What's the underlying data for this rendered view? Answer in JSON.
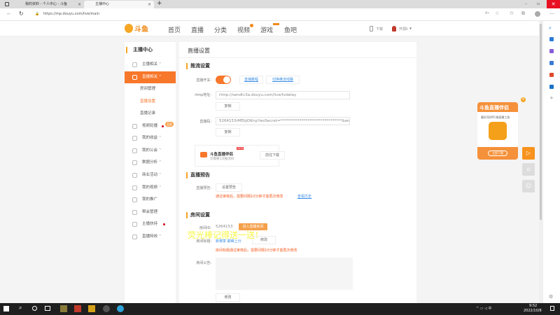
{
  "browser": {
    "tabs": [
      {
        "label": "我的资料 - 个人中心 - 斗鱼"
      },
      {
        "label": "主播中心"
      }
    ],
    "new_tab": "+",
    "url": "https://mp.douyu.com/live/main",
    "close": "×"
  },
  "header": {
    "logo": "斗鱼",
    "nav": [
      "首页",
      "直播",
      "分类",
      "视频",
      "游戏",
      "鱼吧"
    ],
    "download": "下载",
    "user": "开源li"
  },
  "sidebar": {
    "title": "主播中心",
    "items": [
      {
        "label": "主播相关",
        "type": "item"
      },
      {
        "label": "直播相关",
        "type": "active"
      },
      {
        "label": "房间管理",
        "type": "sub"
      },
      {
        "label": "直播设置",
        "type": "sub-active"
      },
      {
        "label": "直播记录",
        "type": "sub"
      },
      {
        "label": "视频轮播",
        "type": "item",
        "badge": "奖励"
      },
      {
        "label": "我的收益",
        "type": "item"
      },
      {
        "label": "我的公会",
        "type": "item"
      },
      {
        "label": "数据分析",
        "type": "item"
      },
      {
        "label": "商业活动",
        "type": "item"
      },
      {
        "label": "我的视频",
        "type": "item"
      },
      {
        "label": "我的推广",
        "type": "item"
      },
      {
        "label": "帮会管理",
        "type": "item"
      },
      {
        "label": "主播扶持",
        "type": "item"
      },
      {
        "label": "直播特效",
        "type": "item"
      }
    ]
  },
  "main": {
    "title": "直播设置",
    "push": {
      "heading": "推流设置",
      "switch_label": "直播开关:",
      "switch_on": true,
      "tutorial": "直播教程",
      "switch_line": "切换推流线路",
      "rtmp_label": "rtmp地址:",
      "rtmp_value": "rtmp://sendtc3a.douyu.com/live",
      "rtmp_suffix": "/tvdelay",
      "copy": "复制",
      "code_label": "直播码:",
      "code_value": "5264153rMEbJOKnp?wsSecret=********************************&wsT",
      "copy2": "复制"
    },
    "promo": {
      "title": "斗鱼直播伴侣",
      "badge": "NEW",
      "subtitle": "仅需要1次推流码",
      "button": "前往下载"
    },
    "preview": {
      "heading": "直播预告",
      "label": "直播预告:",
      "button": "设置预告",
      "warning": "通过审核后，需要间隔10分钟才能再次修改",
      "history": "查看历史"
    },
    "room": {
      "heading": "房间设置",
      "id_label": "房间ID:",
      "id": "5264153",
      "enter": "进入直播房间",
      "title_label": "房间标题:",
      "title_value": "新赛季 巅峰上分",
      "modify": "修改",
      "title_warning": "房间标题通过审核后，需要间隔10分钟才能再次修改",
      "notice_label": "房间公告:",
      "modify2": "修改",
      "overlay": "荧光棒记得送一送！"
    }
  },
  "floating": {
    "title": "斗鱼直播伴侣",
    "subtitle": "最好用的PC端直播工具",
    "button": "立即下载"
  },
  "taskbar": {
    "time": "9:52",
    "date": "2022/10/8"
  },
  "colors": {
    "accent": "#f7772b",
    "warn": "#f55a1e",
    "link": "#3a8ee6"
  }
}
